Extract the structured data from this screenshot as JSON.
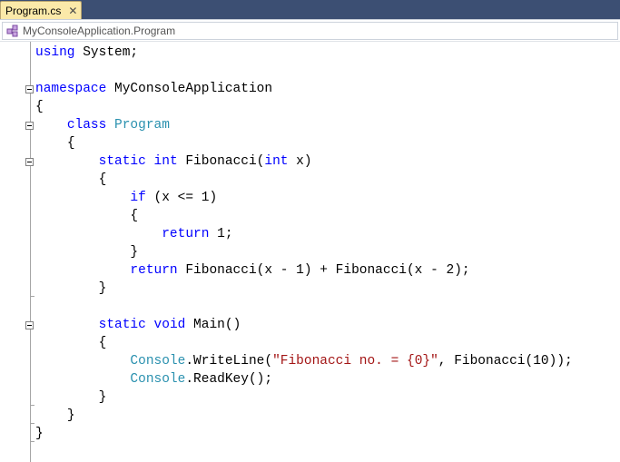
{
  "tab": {
    "label": "Program.cs",
    "close": "✕"
  },
  "nav": {
    "label": "MyConsoleApplication.Program"
  },
  "code": {
    "l1": [
      "using",
      " System;"
    ],
    "l3": [
      "namespace",
      " MyConsoleApplication"
    ],
    "l4": "{",
    "l5": [
      "class",
      "Program"
    ],
    "l6": "{",
    "l7": [
      "static",
      "int",
      " Fibonacci(",
      "int",
      " x)"
    ],
    "l8": "{",
    "l9": [
      "if",
      " (x <= 1)"
    ],
    "l10": "{",
    "l11": [
      "return",
      " 1;"
    ],
    "l12": "}",
    "l13": [
      "return",
      " Fibonacci(x - 1) + Fibonacci(x - 2);"
    ],
    "l14": "}",
    "l16": [
      "static",
      "void",
      " Main()"
    ],
    "l17": "{",
    "l18": [
      "Console",
      ".WriteLine(",
      "\"Fibonacci no. = {0}\"",
      ", Fibonacci(10));"
    ],
    "l19": [
      "Console",
      ".ReadKey();"
    ],
    "l20": "}",
    "l21": "}",
    "l22": "}"
  },
  "colors": {
    "keyword": "#0000ff",
    "type": "#2b91af",
    "string": "#a31515"
  }
}
